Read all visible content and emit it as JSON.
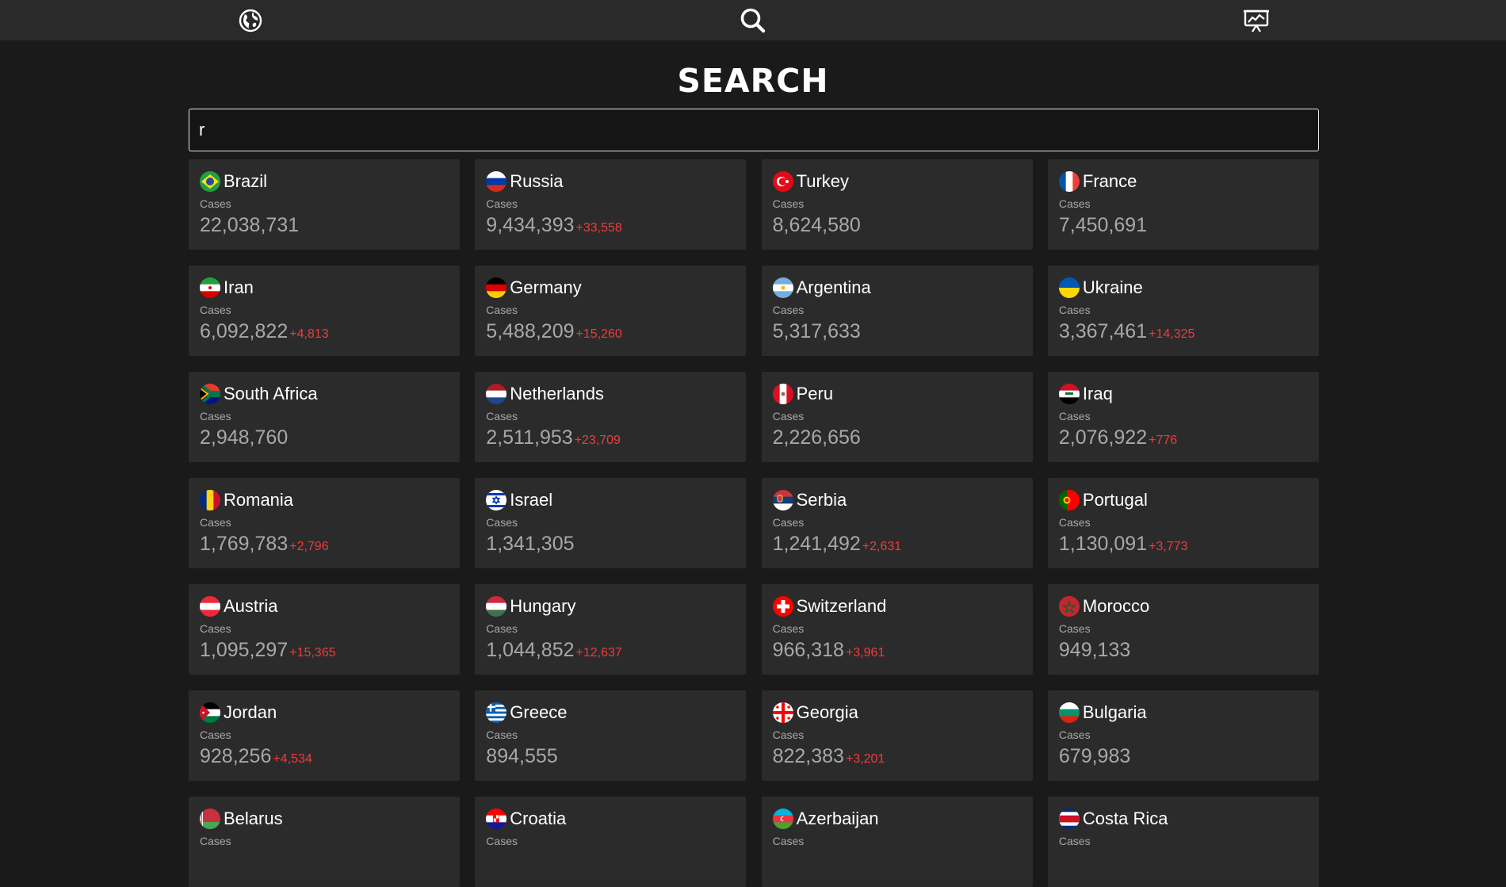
{
  "nav": {
    "items": [
      {
        "icon": "globe-icon"
      },
      {
        "icon": "search-icon"
      },
      {
        "icon": "chart-presentation-icon"
      }
    ]
  },
  "page": {
    "title": "SEARCH"
  },
  "search": {
    "value": "r"
  },
  "colors": {
    "background": "#1b1a1a",
    "card": "#2c2b2b",
    "delta": "#ef3b3b"
  },
  "countries": [
    {
      "name": "Brazil",
      "label": "Cases",
      "cases": "22,038,731",
      "delta": "",
      "flag": "brazil"
    },
    {
      "name": "Russia",
      "label": "Cases",
      "cases": "9,434,393",
      "delta": "+33,558",
      "flag": "russia"
    },
    {
      "name": "Turkey",
      "label": "Cases",
      "cases": "8,624,580",
      "delta": "",
      "flag": "turkey"
    },
    {
      "name": "France",
      "label": "Cases",
      "cases": "7,450,691",
      "delta": "",
      "flag": "france"
    },
    {
      "name": "Iran",
      "label": "Cases",
      "cases": "6,092,822",
      "delta": "+4,813",
      "flag": "iran"
    },
    {
      "name": "Germany",
      "label": "Cases",
      "cases": "5,488,209",
      "delta": "+15,260",
      "flag": "germany"
    },
    {
      "name": "Argentina",
      "label": "Cases",
      "cases": "5,317,633",
      "delta": "",
      "flag": "argentina"
    },
    {
      "name": "Ukraine",
      "label": "Cases",
      "cases": "3,367,461",
      "delta": "+14,325",
      "flag": "ukraine"
    },
    {
      "name": "South Africa",
      "label": "Cases",
      "cases": "2,948,760",
      "delta": "",
      "flag": "south-africa"
    },
    {
      "name": "Netherlands",
      "label": "Cases",
      "cases": "2,511,953",
      "delta": "+23,709",
      "flag": "netherlands"
    },
    {
      "name": "Peru",
      "label": "Cases",
      "cases": "2,226,656",
      "delta": "",
      "flag": "peru"
    },
    {
      "name": "Iraq",
      "label": "Cases",
      "cases": "2,076,922",
      "delta": "+776",
      "flag": "iraq"
    },
    {
      "name": "Romania",
      "label": "Cases",
      "cases": "1,769,783",
      "delta": "+2,796",
      "flag": "romania"
    },
    {
      "name": "Israel",
      "label": "Cases",
      "cases": "1,341,305",
      "delta": "",
      "flag": "israel"
    },
    {
      "name": "Serbia",
      "label": "Cases",
      "cases": "1,241,492",
      "delta": "+2,631",
      "flag": "serbia"
    },
    {
      "name": "Portugal",
      "label": "Cases",
      "cases": "1,130,091",
      "delta": "+3,773",
      "flag": "portugal"
    },
    {
      "name": "Austria",
      "label": "Cases",
      "cases": "1,095,297",
      "delta": "+15,365",
      "flag": "austria"
    },
    {
      "name": "Hungary",
      "label": "Cases",
      "cases": "1,044,852",
      "delta": "+12,637",
      "flag": "hungary"
    },
    {
      "name": "Switzerland",
      "label": "Cases",
      "cases": "966,318",
      "delta": "+3,961",
      "flag": "switzerland"
    },
    {
      "name": "Morocco",
      "label": "Cases",
      "cases": "949,133",
      "delta": "",
      "flag": "morocco"
    },
    {
      "name": "Jordan",
      "label": "Cases",
      "cases": "928,256",
      "delta": "+4,534",
      "flag": "jordan"
    },
    {
      "name": "Greece",
      "label": "Cases",
      "cases": "894,555",
      "delta": "",
      "flag": "greece"
    },
    {
      "name": "Georgia",
      "label": "Cases",
      "cases": "822,383",
      "delta": "+3,201",
      "flag": "georgia"
    },
    {
      "name": "Bulgaria",
      "label": "Cases",
      "cases": "679,983",
      "delta": "",
      "flag": "bulgaria"
    },
    {
      "name": "Belarus",
      "label": "Cases",
      "cases": "",
      "delta": "",
      "flag": "belarus"
    },
    {
      "name": "Croatia",
      "label": "Cases",
      "cases": "",
      "delta": "",
      "flag": "croatia"
    },
    {
      "name": "Azerbaijan",
      "label": "Cases",
      "cases": "",
      "delta": "",
      "flag": "azerbaijan"
    },
    {
      "name": "Costa Rica",
      "label": "Cases",
      "cases": "",
      "delta": "",
      "flag": "costa-rica"
    }
  ]
}
